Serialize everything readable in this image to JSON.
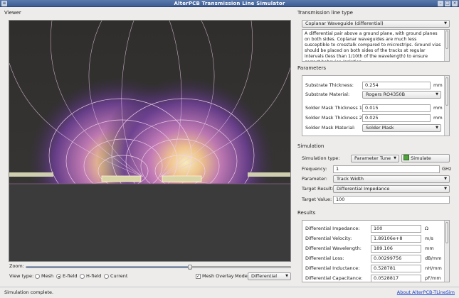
{
  "window": {
    "title": "AlterPCB Transmission Line Simulator"
  },
  "viewer": {
    "label": "Viewer",
    "zoom_label": "Zoom:",
    "zoom_level": 0.62,
    "view_type_label": "View type:",
    "view_types": [
      "Mesh",
      "E-field",
      "H-field",
      "Current"
    ],
    "selected_view": "E-field",
    "mesh_overlay_label": "Mesh Overlay",
    "mesh_overlay_checked": true,
    "mode_label": "Mode:",
    "mode_value": "Differential"
  },
  "tline": {
    "label": "Transmission line type",
    "type_value": "Coplanar Waveguide (differential)",
    "description": "A differential pair above a ground plane, with ground planes on both sides. Coplanar waveguides are much less susceptible to crosstalk compared to microstrips. Ground vias should be placed on both sides of the tracks at regular intervals (less than 1/10th of the wavelength) to ensure correct behavior. Isolation"
  },
  "parameters": {
    "label": "Parameters",
    "rows": [
      {
        "label": "Substrate Thickness:",
        "value": "0.254",
        "unit": "mm",
        "kind": "input"
      },
      {
        "label": "Substrate Material:",
        "value": "Rogers RO4350B",
        "unit": "",
        "kind": "combo"
      },
      {
        "label": "Solder Mask Thickness 1:",
        "value": "0.015",
        "unit": "mm",
        "kind": "input"
      },
      {
        "label": "Solder Mask Thickness 2:",
        "value": "0.025",
        "unit": "mm",
        "kind": "input"
      },
      {
        "label": "Solder Mask Material:",
        "value": "Solder Mask",
        "unit": "",
        "kind": "combo"
      }
    ]
  },
  "simulation": {
    "label": "Simulation",
    "type_label": "Simulation type:",
    "type_value": "Parameter Tune",
    "simulate_label": "Simulate",
    "frequency_label": "Frequency:",
    "frequency_value": "1",
    "frequency_unit": "GHz",
    "parameter_label": "Parameter:",
    "parameter_value": "Track Width",
    "target_result_label": "Target Result:",
    "target_result_value": "Differential Impedance",
    "target_value_label": "Target Value:",
    "target_value": "100"
  },
  "results": {
    "label": "Results",
    "rows": [
      {
        "label": "Differential Impedance:",
        "value": "100",
        "unit": "Ω"
      },
      {
        "label": "Differential Velocity:",
        "value": "1.89106e+8",
        "unit": "m/s"
      },
      {
        "label": "Differential Wavelength:",
        "value": "189.106",
        "unit": "mm"
      },
      {
        "label": "Differential Loss:",
        "value": "0.00299756",
        "unit": "dB/mm"
      },
      {
        "label": "Differential Inductance:",
        "value": "0.528781",
        "unit": "nH/mm"
      },
      {
        "label": "Differential Capacitance:",
        "value": "0.0528817",
        "unit": "pF/mm"
      }
    ]
  },
  "statusbar": {
    "status": "Simulation complete.",
    "about_link": "About AlterPCB-TLineSim"
  },
  "colors": {
    "titlebar": "#4a6a9f",
    "link": "#1a3fc9",
    "field_hot": "#ffe9a0",
    "field_mid": "#b05cb5",
    "field_cool": "#3b2c5e"
  }
}
